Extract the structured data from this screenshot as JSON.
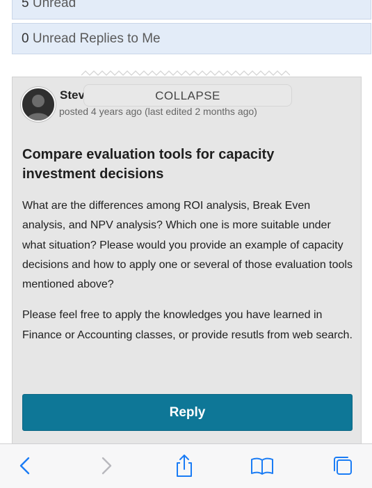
{
  "unread": {
    "top_count": "5",
    "top_label": "Unread",
    "replies_count": "0",
    "replies_label": "Unread Replies to Me"
  },
  "post": {
    "author": "Stev",
    "collapse_label": "COLLAPSE",
    "meta": "posted 4 years ago (last edited 2 months ago)",
    "title": "Compare evaluation tools for capacity investment decisions",
    "body_p1": "What are the differences among ROI analysis, Break Even analysis, and NPV analysis? Which one is more suitable under what situation? Please would you provide an example of capacity decisions and how to apply one or several of those evaluation tools mentioned above?",
    "body_p2": "Please feel free to apply the knowledges you have learned in Finance or Accounting classes, or provide resutls from web search.",
    "reply_label": "Reply"
  },
  "toolbar": {
    "icons": [
      "back-icon",
      "forward-icon",
      "share-icon",
      "bookmarks-icon",
      "tabs-icon"
    ]
  },
  "colors": {
    "accent": "#0e7797",
    "ios_blue": "#1a7cf5",
    "unread_bg": "#e3ecf8",
    "card_bg": "#e6e6e6"
  }
}
